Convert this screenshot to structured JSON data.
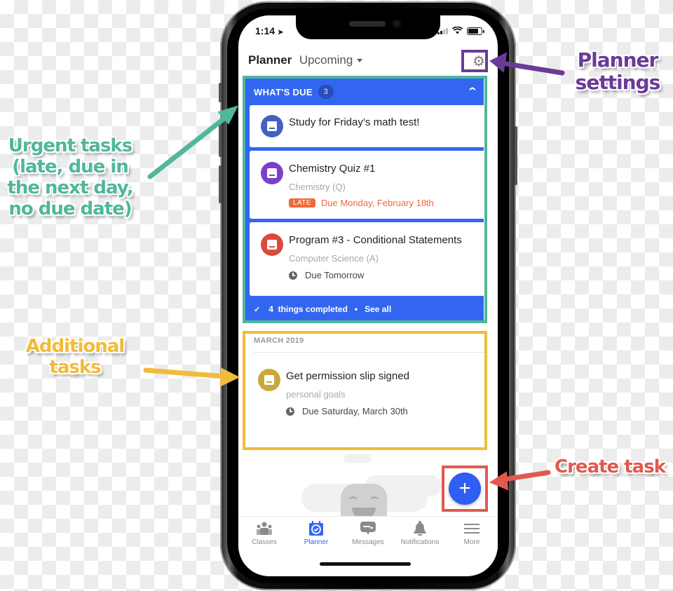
{
  "status_bar": {
    "time": "1:14",
    "location_icon": "location-arrow-icon"
  },
  "header": {
    "title": "Planner",
    "view": "Upcoming",
    "settings_icon": "gear-icon"
  },
  "whats_due": {
    "title": "WHAT'S DUE",
    "count": "3",
    "collapse_icon": "chevron-up-icon",
    "items": [
      {
        "title": "Study for Friday’s math test!",
        "icon": "note-icon",
        "color": "#4560c4"
      },
      {
        "title": "Chemistry Quiz #1",
        "subtitle": "Chemistry (Q)",
        "badge": "LATE",
        "due": "Due Monday, February 18th",
        "icon": "quiz-icon",
        "color": "#7a3fc8"
      },
      {
        "title": "Program #3 - Conditional Statements",
        "subtitle": "Computer Science (A)",
        "due": "Due Tomorrow",
        "icon": "assignment-icon",
        "color": "#d94a3b"
      }
    ],
    "completed_count": "4",
    "completed_label": "things completed",
    "see_all": "See all"
  },
  "upcoming": {
    "month": "MARCH 2019",
    "items": [
      {
        "title": "Get permission slip signed",
        "subtitle": "personal goals",
        "due": "Due Saturday, March 30th",
        "icon": "event-icon",
        "color": "#c9a93a"
      }
    ]
  },
  "fab": {
    "label": "+"
  },
  "tabs": [
    {
      "label": "Classes",
      "icon": "classes-icon",
      "active": false
    },
    {
      "label": "Planner",
      "icon": "planner-icon",
      "active": true
    },
    {
      "label": "Messages",
      "icon": "messages-icon",
      "active": false
    },
    {
      "label": "Notifications",
      "icon": "bell-icon",
      "active": false
    },
    {
      "label": "More",
      "icon": "menu-icon",
      "active": false
    }
  ],
  "annotations": {
    "urgent": "Urgent tasks (late, due in the next day, no due date)",
    "additional": "Additional tasks",
    "settings": "Planner settings",
    "create": "Create task"
  },
  "colors": {
    "primary_blue": "#3366f0",
    "teal": "#4fb79c",
    "gold": "#f1bb3b",
    "purple": "#6a3b97",
    "red": "#e05a4e",
    "late": "#ef6a3c"
  }
}
